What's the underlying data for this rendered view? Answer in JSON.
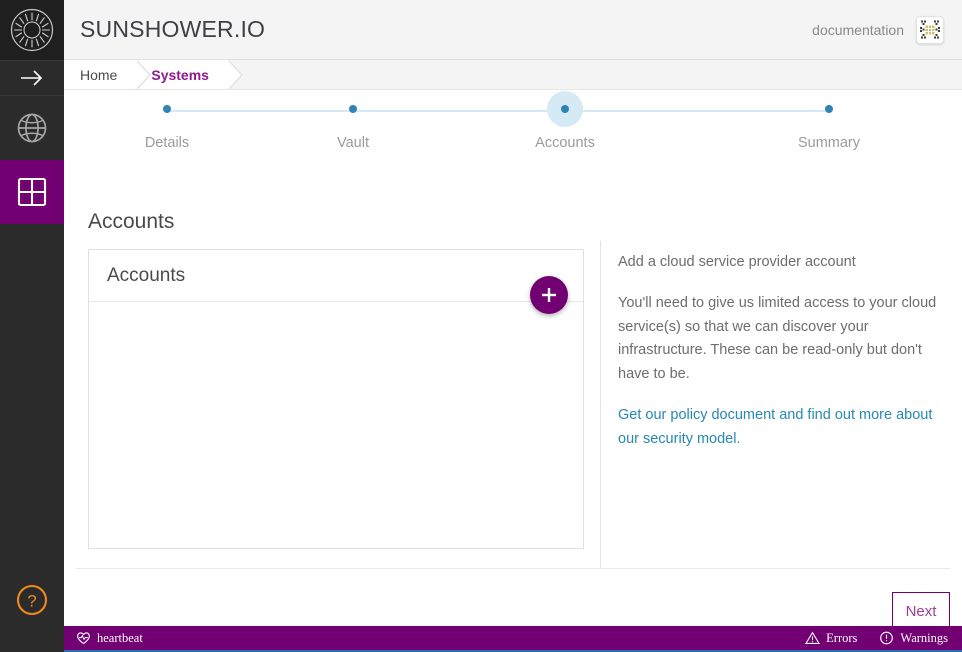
{
  "app": {
    "brand": "SUNSHOWER.IO",
    "logo_icon": "sunburst-logo-icon"
  },
  "topbar": {
    "documentation_label": "documentation",
    "avatar_icon": "identicon-avatar"
  },
  "breadcrumb": {
    "items": [
      {
        "label": "Home",
        "active": false
      },
      {
        "label": "Systems",
        "active": true
      }
    ]
  },
  "rail": {
    "collapse_icon": "arrow-right-icon",
    "items": [
      {
        "icon": "globe-icon",
        "name": "globe",
        "active": false
      },
      {
        "icon": "grid-icon",
        "name": "dashboard",
        "active": true
      }
    ],
    "help_icon": "question-circle-icon"
  },
  "stepper": {
    "steps": [
      {
        "label": "Details",
        "active": false
      },
      {
        "label": "Vault",
        "active": false
      },
      {
        "label": "Accounts",
        "active": true
      },
      {
        "label": "Summary",
        "active": false
      }
    ],
    "track_color": "#d4e9f5",
    "dot_color": "#3083b5",
    "active_halo_color": "#d6eaf5"
  },
  "main": {
    "page_title": "Accounts",
    "card": {
      "header": "Accounts",
      "add_icon": "plus-icon",
      "rows": []
    },
    "side": {
      "heading": "Add a cloud service provider account",
      "body": "You'll need to give us limited access to your cloud service(s) so that we can discover your infrastructure. These can be read-only but don't have to be.",
      "link": "Get our policy document and find out more about our security model."
    },
    "next_label": "Next"
  },
  "statusbar": {
    "heartbeat_icon": "heartbeat-icon",
    "heartbeat_label": "heartbeat",
    "errors_icon": "warning-triangle-icon",
    "errors_label": "Errors",
    "warnings_icon": "exclamation-circle-icon",
    "warnings_label": "Warnings"
  },
  "colors": {
    "brand_purple": "#730073",
    "accent_blue": "#2688b5",
    "link_blue": "#2688b5",
    "help_orange": "#f08a1e",
    "rail_dark": "#2b2b2b"
  }
}
